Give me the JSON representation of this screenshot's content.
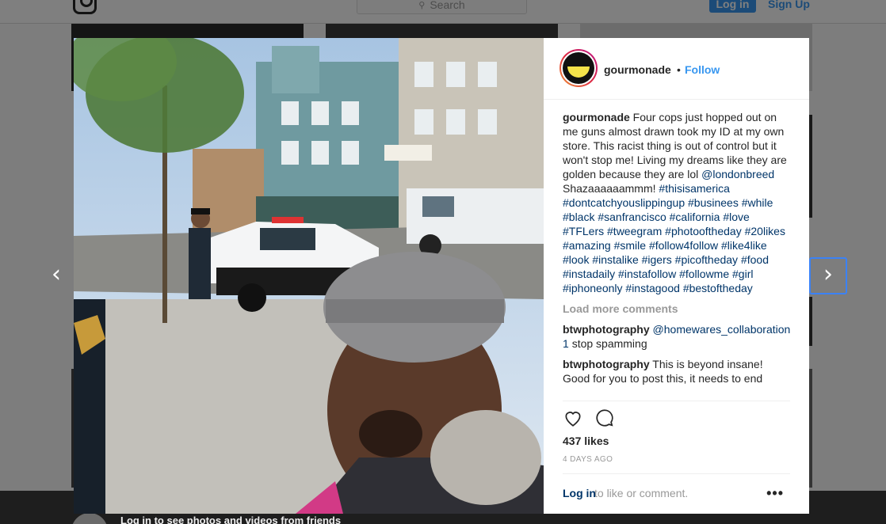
{
  "nav": {
    "search_placeholder": "Search",
    "login_label": "Log in",
    "signup_label": "Sign Up"
  },
  "banner": {
    "text": "Log in to see photos and videos from friends"
  },
  "post": {
    "username": "gourmonade",
    "follow_label": "Follow",
    "caption_text": "Four cops just hopped out on me guns almost drawn took my ID at my own store. This racist thing is out of control but it won't stop me! Living my dreams like they are golden because they are lol",
    "mention": "@londonbreed",
    "caption_after_mention": "Shazaaaaaammm!",
    "hashtags": [
      "#thisisamerica",
      "#dontcatchyouslippingup",
      "#businees",
      "#while",
      "#black",
      "#sanfrancisco",
      "#california",
      "#love",
      "#TFLers",
      "#tweegram",
      "#photooftheday",
      "#20likes",
      "#amazing",
      "#smile",
      "#follow4follow",
      "#like4like",
      "#look",
      "#instalike",
      "#igers",
      "#picoftheday",
      "#food",
      "#instadaily",
      "#instafollow",
      "#followme",
      "#girl",
      "#iphoneonly",
      "#instagood",
      "#bestoftheday"
    ],
    "load_more_label": "Load more comments",
    "comments": [
      {
        "user": "btwphotography",
        "mention": "@homewares_collaboration1",
        "text": "stop spamming"
      },
      {
        "user": "btwphotography",
        "mention": "",
        "text": "This is beyond insane! Good for you to post this, it needs to end"
      }
    ],
    "likes": "437 likes",
    "date": "4 DAYS AGO",
    "footer_login": "Log in",
    "footer_rest": "to like or comment.",
    "more_label": "•••"
  },
  "icons": {
    "prev": "chevron-left-icon",
    "next": "chevron-right-icon",
    "like": "heart-icon",
    "comment": "comment-icon",
    "more": "more-options-icon"
  },
  "colors": {
    "link_blue": "#3897f0",
    "hashtag_blue": "#003569"
  }
}
